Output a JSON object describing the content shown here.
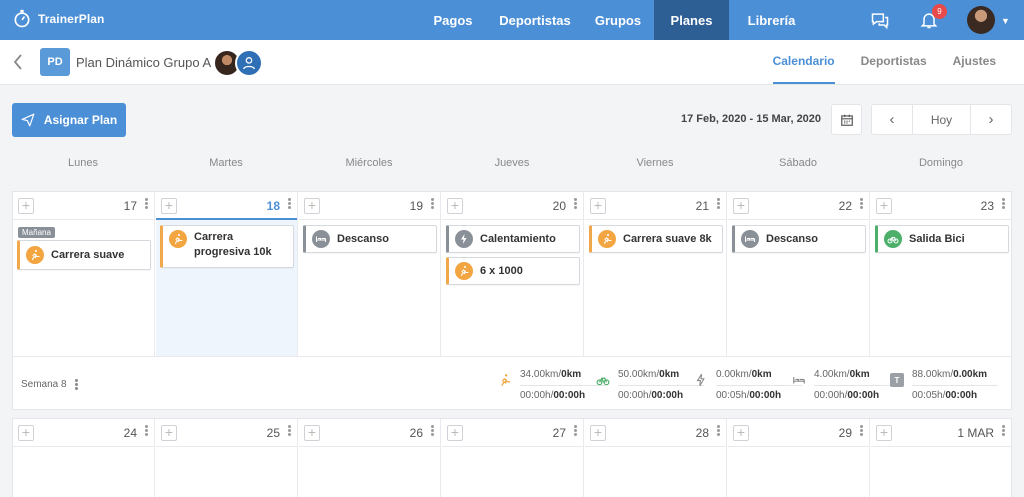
{
  "nav": {
    "brand": "TrainerPlan",
    "links": [
      {
        "label": "Pagos",
        "w": 70,
        "active": false
      },
      {
        "label": "Deportistas",
        "w": 94,
        "active": false
      },
      {
        "label": "Grupos",
        "w": 72,
        "active": false
      },
      {
        "label": "Planes",
        "w": 75,
        "active": true
      },
      {
        "label": "Librería",
        "w": 85,
        "active": false
      }
    ],
    "notifications": "9"
  },
  "header": {
    "badge": "PD",
    "title": "Plan Dinámico Grupo A",
    "tabs": [
      {
        "label": "Calendario",
        "active": true
      },
      {
        "label": "Deportistas",
        "active": false
      },
      {
        "label": "Ajustes",
        "active": false
      }
    ]
  },
  "toolbar": {
    "assign_label": "Asignar Plan",
    "date_range": "17 Feb, 2020 - 15 Mar, 2020",
    "today_label": "Hoy"
  },
  "weekdays": [
    "Lunes",
    "Martes",
    "Miércoles",
    "Jueves",
    "Viernes",
    "Sábado",
    "Domingo"
  ],
  "week1": {
    "days": [
      "17",
      "18",
      "19",
      "20",
      "21",
      "22",
      "23"
    ],
    "manana_tag": "Mañana",
    "sessions": {
      "mon": "Carrera suave",
      "tue": "Carrera progresiva 10k",
      "wed": "Descanso",
      "thu_1": "Calentamiento",
      "thu_2": "6 x 1000",
      "fri": "Carrera suave 8k",
      "sat": "Descanso",
      "sun": "Salida Bici"
    },
    "summary": {
      "label": "Semana 8",
      "run": {
        "dist_done": "34.00km/",
        "dist_plan": "0km",
        "time_done": "00:00h/",
        "time_plan": "00:00h"
      },
      "bike": {
        "dist_done": "50.00km/",
        "dist_plan": "0km",
        "time_done": "00:00h/",
        "time_plan": "00:00h"
      },
      "other": {
        "dist_done": "0.00km/",
        "dist_plan": "0km",
        "time_done": "00:05h/",
        "time_plan": "00:00h"
      },
      "rest": {
        "dist_done": "4.00km/",
        "dist_plan": "0km",
        "time_done": "00:00h/",
        "time_plan": "00:00h"
      },
      "total": {
        "dist_done": "88.00km/",
        "dist_plan": "0.00km",
        "time_done": "00:05h/",
        "time_plan": "00:00h"
      }
    }
  },
  "week2": {
    "days": [
      "24",
      "25",
      "26",
      "27",
      "28",
      "29",
      "1 MAR"
    ]
  },
  "colors": {
    "primary": "#4b8fd6",
    "run": "#f2a540",
    "bike": "#4caf6a",
    "rest": "#8a9098"
  }
}
